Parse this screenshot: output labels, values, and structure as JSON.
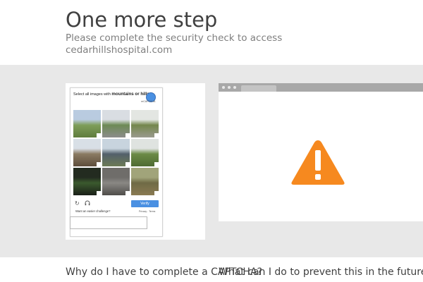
{
  "header": {
    "title": "One more step",
    "subtitle": "Please complete the security check to access cedarhillshospital.com"
  },
  "captcha": {
    "prompt_prefix": "Select all images with ",
    "prompt_target": "mountains or hills",
    "prompt_suffix": ".",
    "logo_label": "reCAPTCHA",
    "verify_label": "Verify",
    "easier_label": "Want an easier challenge?",
    "privacy_label": "Privacy - Terms",
    "tiles": [
      {
        "name": "tile-1",
        "colors": [
          "#b9cbe0",
          "#7e9e5a",
          "#5f7c3d"
        ]
      },
      {
        "name": "tile-2",
        "colors": [
          "#d9dde2",
          "#6d8a55",
          "#8c8c8c"
        ]
      },
      {
        "name": "tile-3",
        "colors": [
          "#e3e6e2",
          "#74874c",
          "#9a9a8e"
        ]
      },
      {
        "name": "tile-4",
        "colors": [
          "#d8dfe6",
          "#8a7a62",
          "#5d4d3b"
        ]
      },
      {
        "name": "tile-5",
        "colors": [
          "#c8d4de",
          "#53606b",
          "#6c7a56"
        ]
      },
      {
        "name": "tile-6",
        "colors": [
          "#dfe3e0",
          "#6b8a46",
          "#4f6b32"
        ]
      },
      {
        "name": "tile-7",
        "colors": [
          "#232b20",
          "#3b5a2e",
          "#1a1f18"
        ]
      },
      {
        "name": "tile-8",
        "colors": [
          "#6f6d6a",
          "#8a8884",
          "#4f4d4a"
        ]
      },
      {
        "name": "tile-9",
        "colors": [
          "#a1a47a",
          "#6f6a45",
          "#8a7a52"
        ]
      }
    ]
  },
  "icons": {
    "reload": "reload-icon",
    "audio": "headphones-icon",
    "warning": "warning-icon"
  },
  "colors": {
    "band": "#e8e8e8",
    "warning": "#f6891f",
    "verify": "#4a90e2"
  },
  "bottom": {
    "left_heading": "Why do I have to complete a CAPTCHA?",
    "right_heading": "What can I do to prevent this in the future?"
  }
}
